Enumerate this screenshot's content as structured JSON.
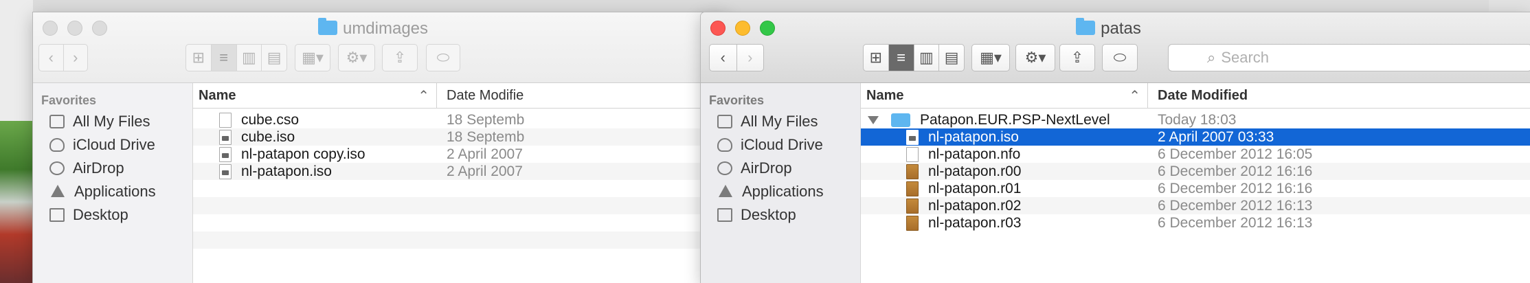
{
  "window_left": {
    "title": "umdimages",
    "toolbar": {
      "back": "‹",
      "forward": "›",
      "arrange_icon": "arrange-icon",
      "action_icon": "gear-icon",
      "share_icon": "share-icon",
      "tag_icon": "tag-icon"
    },
    "sidebar": {
      "heading": "Favorites",
      "items": [
        {
          "label": "All My Files",
          "icon": "all-files-icon"
        },
        {
          "label": "iCloud Drive",
          "icon": "cloud-icon"
        },
        {
          "label": "AirDrop",
          "icon": "airdrop-icon"
        },
        {
          "label": "Applications",
          "icon": "applications-icon"
        },
        {
          "label": "Desktop",
          "icon": "desktop-icon"
        }
      ]
    },
    "columns": {
      "name": "Name",
      "date": "Date Modifie"
    },
    "files": [
      {
        "name": "cube.cso",
        "date": "18 Septemb",
        "icon": "document-icon"
      },
      {
        "name": "cube.iso",
        "date": "18 Septemb",
        "icon": "disk-image-icon"
      },
      {
        "name": "nl-patapon copy.iso",
        "date": "2 April 2007",
        "icon": "disk-image-icon"
      },
      {
        "name": "nl-patapon.iso",
        "date": "2 April 2007",
        "icon": "disk-image-icon"
      }
    ]
  },
  "window_right": {
    "title": "patas",
    "search": {
      "placeholder": "Search"
    },
    "sidebar": {
      "heading": "Favorites",
      "items": [
        {
          "label": "All My Files",
          "icon": "all-files-icon"
        },
        {
          "label": "iCloud Drive",
          "icon": "cloud-icon"
        },
        {
          "label": "AirDrop",
          "icon": "airdrop-icon"
        },
        {
          "label": "Applications",
          "icon": "applications-icon"
        },
        {
          "label": "Desktop",
          "icon": "desktop-icon"
        }
      ]
    },
    "columns": {
      "name": "Name",
      "date": "Date Modified"
    },
    "folder": {
      "name": "Patapon.EUR.PSP-NextLevel",
      "date": "Today 18:03"
    },
    "files": [
      {
        "name": "nl-patapon.iso",
        "date": "2 April 2007 03:33",
        "icon": "disk-image-icon",
        "selected": true
      },
      {
        "name": "nl-patapon.nfo",
        "date": "6 December 2012 16:05",
        "icon": "document-icon"
      },
      {
        "name": "nl-patapon.r00",
        "date": "6 December 2012 16:16",
        "icon": "rar-archive-icon"
      },
      {
        "name": "nl-patapon.r01",
        "date": "6 December 2012 16:16",
        "icon": "rar-archive-icon"
      },
      {
        "name": "nl-patapon.r02",
        "date": "6 December 2012 16:13",
        "icon": "rar-archive-icon"
      },
      {
        "name": "nl-patapon.r03",
        "date": "6 December 2012 16:13",
        "icon": "rar-archive-icon"
      }
    ]
  },
  "colors": {
    "selection": "#1266d6",
    "folder": "#5eb6f0",
    "close": "#fc5753",
    "minimize": "#fdbc2e",
    "zoom": "#33c748"
  }
}
